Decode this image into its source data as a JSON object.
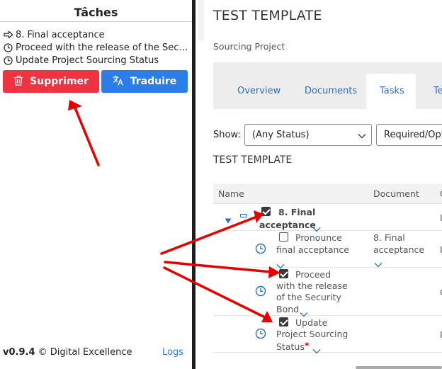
{
  "panel": {
    "title": "Tâches",
    "tasks": [
      {
        "icon": "arrow-right-icon",
        "label": "8. Final acceptance"
      },
      {
        "icon": "clock-icon",
        "label": "Proceed with the release of the Security Bond"
      },
      {
        "icon": "clock-icon",
        "label": "Update Project Sourcing Status"
      }
    ],
    "delete_label": "Supprimer",
    "translate_label": "Traduire",
    "version": "v0.9.4",
    "copyright": " © Digital Excellence",
    "logs_label": "Logs",
    "colors": {
      "delete": "#ef3340",
      "translate": "#2b7de9",
      "annotation": "#e60000"
    }
  },
  "app": {
    "title": "TEST TEMPLATE",
    "subtitle": "Sourcing Project",
    "tabs": [
      "Overview",
      "Documents",
      "Tasks",
      "Te"
    ],
    "active_tab": "Tasks",
    "show_label": "Show:",
    "status_filter": "(Any Status)",
    "type_filter": "Required/Optio",
    "section_title": "TEST TEMPLATE",
    "columns": [
      "Name",
      "Document",
      "C"
    ],
    "rows": [
      {
        "name_line1": "8. Final",
        "name_line2": "acceptance",
        "document": "",
        "extra": "I",
        "checked": true,
        "kind": "milestone"
      },
      {
        "name_line1": "Pronounce",
        "name_line2": "final acceptance",
        "document": "8. Final acceptance",
        "extra": "I",
        "checked": false,
        "kind": "task"
      },
      {
        "name_line1": "Proceed",
        "name_line2": "with the release",
        "name_line3": "of the Security",
        "name_line4": "Bond",
        "document": "",
        "extra": "C",
        "checked": true,
        "kind": "task"
      },
      {
        "name_line1": "Update",
        "name_line2": "Project Sourcing",
        "name_line3": "Status",
        "required_mark": "*",
        "document": "",
        "extra": "I",
        "checked": true,
        "kind": "task"
      }
    ],
    "accent": "#2a6fc9"
  }
}
